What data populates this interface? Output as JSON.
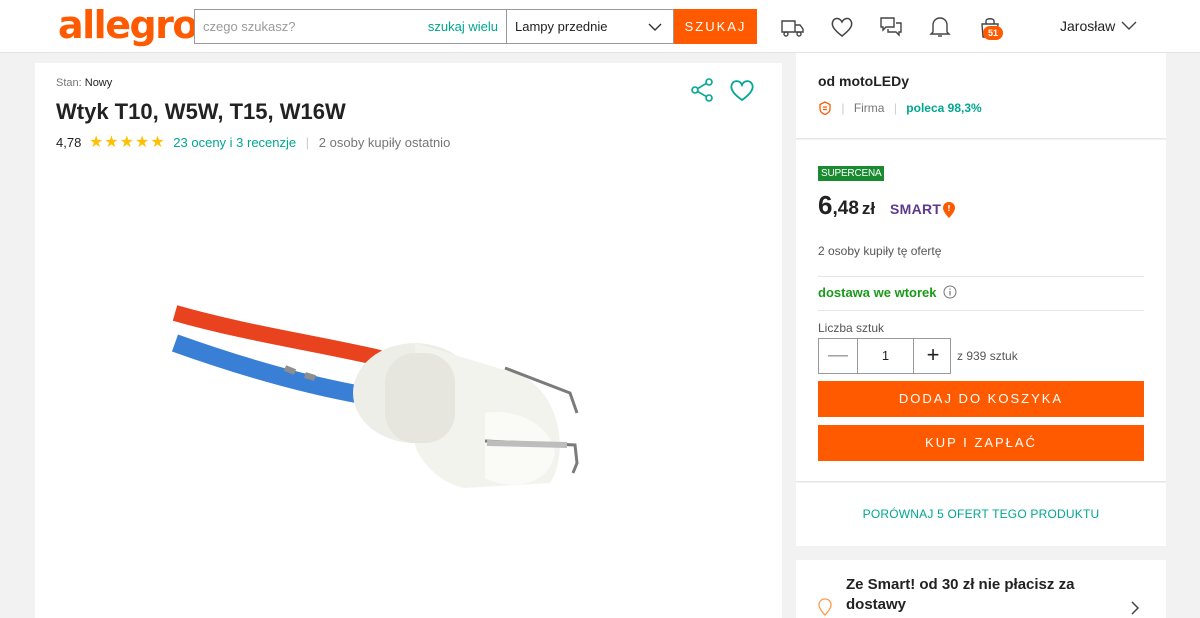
{
  "header": {
    "logo": "allegro",
    "search_placeholder": "czego szukasz?",
    "search_many": "szukaj wielu",
    "category": "Lampy przednie",
    "search_button": "SZUKAJ",
    "cart_count": "51",
    "user": "Jarosław"
  },
  "product": {
    "condition_label": "Stan:",
    "condition_value": "Nowy",
    "title": "Wtyk T10, W5W, T15, W16W",
    "rating": "4,78",
    "stars": 5,
    "reviews": "23 oceny i 3 recenzje",
    "bought_recently": "2 osoby kupiły ostatnio"
  },
  "seller": {
    "name": "od motoLEDy",
    "type": "Firma",
    "recommend": "poleca 98,3%"
  },
  "offer": {
    "badge": "SUPERCENA",
    "price_int": "6",
    "price_dec": ",48",
    "currency": "zł",
    "smart": "SMART",
    "bought_offer": "2 osoby kupiły tę ofertę",
    "delivery": "dostawa we wtorek",
    "qty_label": "Liczba sztuk",
    "qty_value": "1",
    "qty_of": "z 939 sztuk",
    "add_to_cart": "DODAJ DO KOSZYKA",
    "buy_now": "KUP I ZAPŁAĆ"
  },
  "compare": {
    "label": "PORÓWNAJ 5 OFERT TEGO PRODUKTU"
  },
  "smart_promo": {
    "text": "Ze Smart! od 30 zł nie płacisz za dostawy"
  },
  "colors": {
    "brand": "#ff5a00",
    "link": "#00a790",
    "success": "#1a9a1a",
    "supercena": "#1a8a30",
    "smart": "#5e3a8c"
  }
}
